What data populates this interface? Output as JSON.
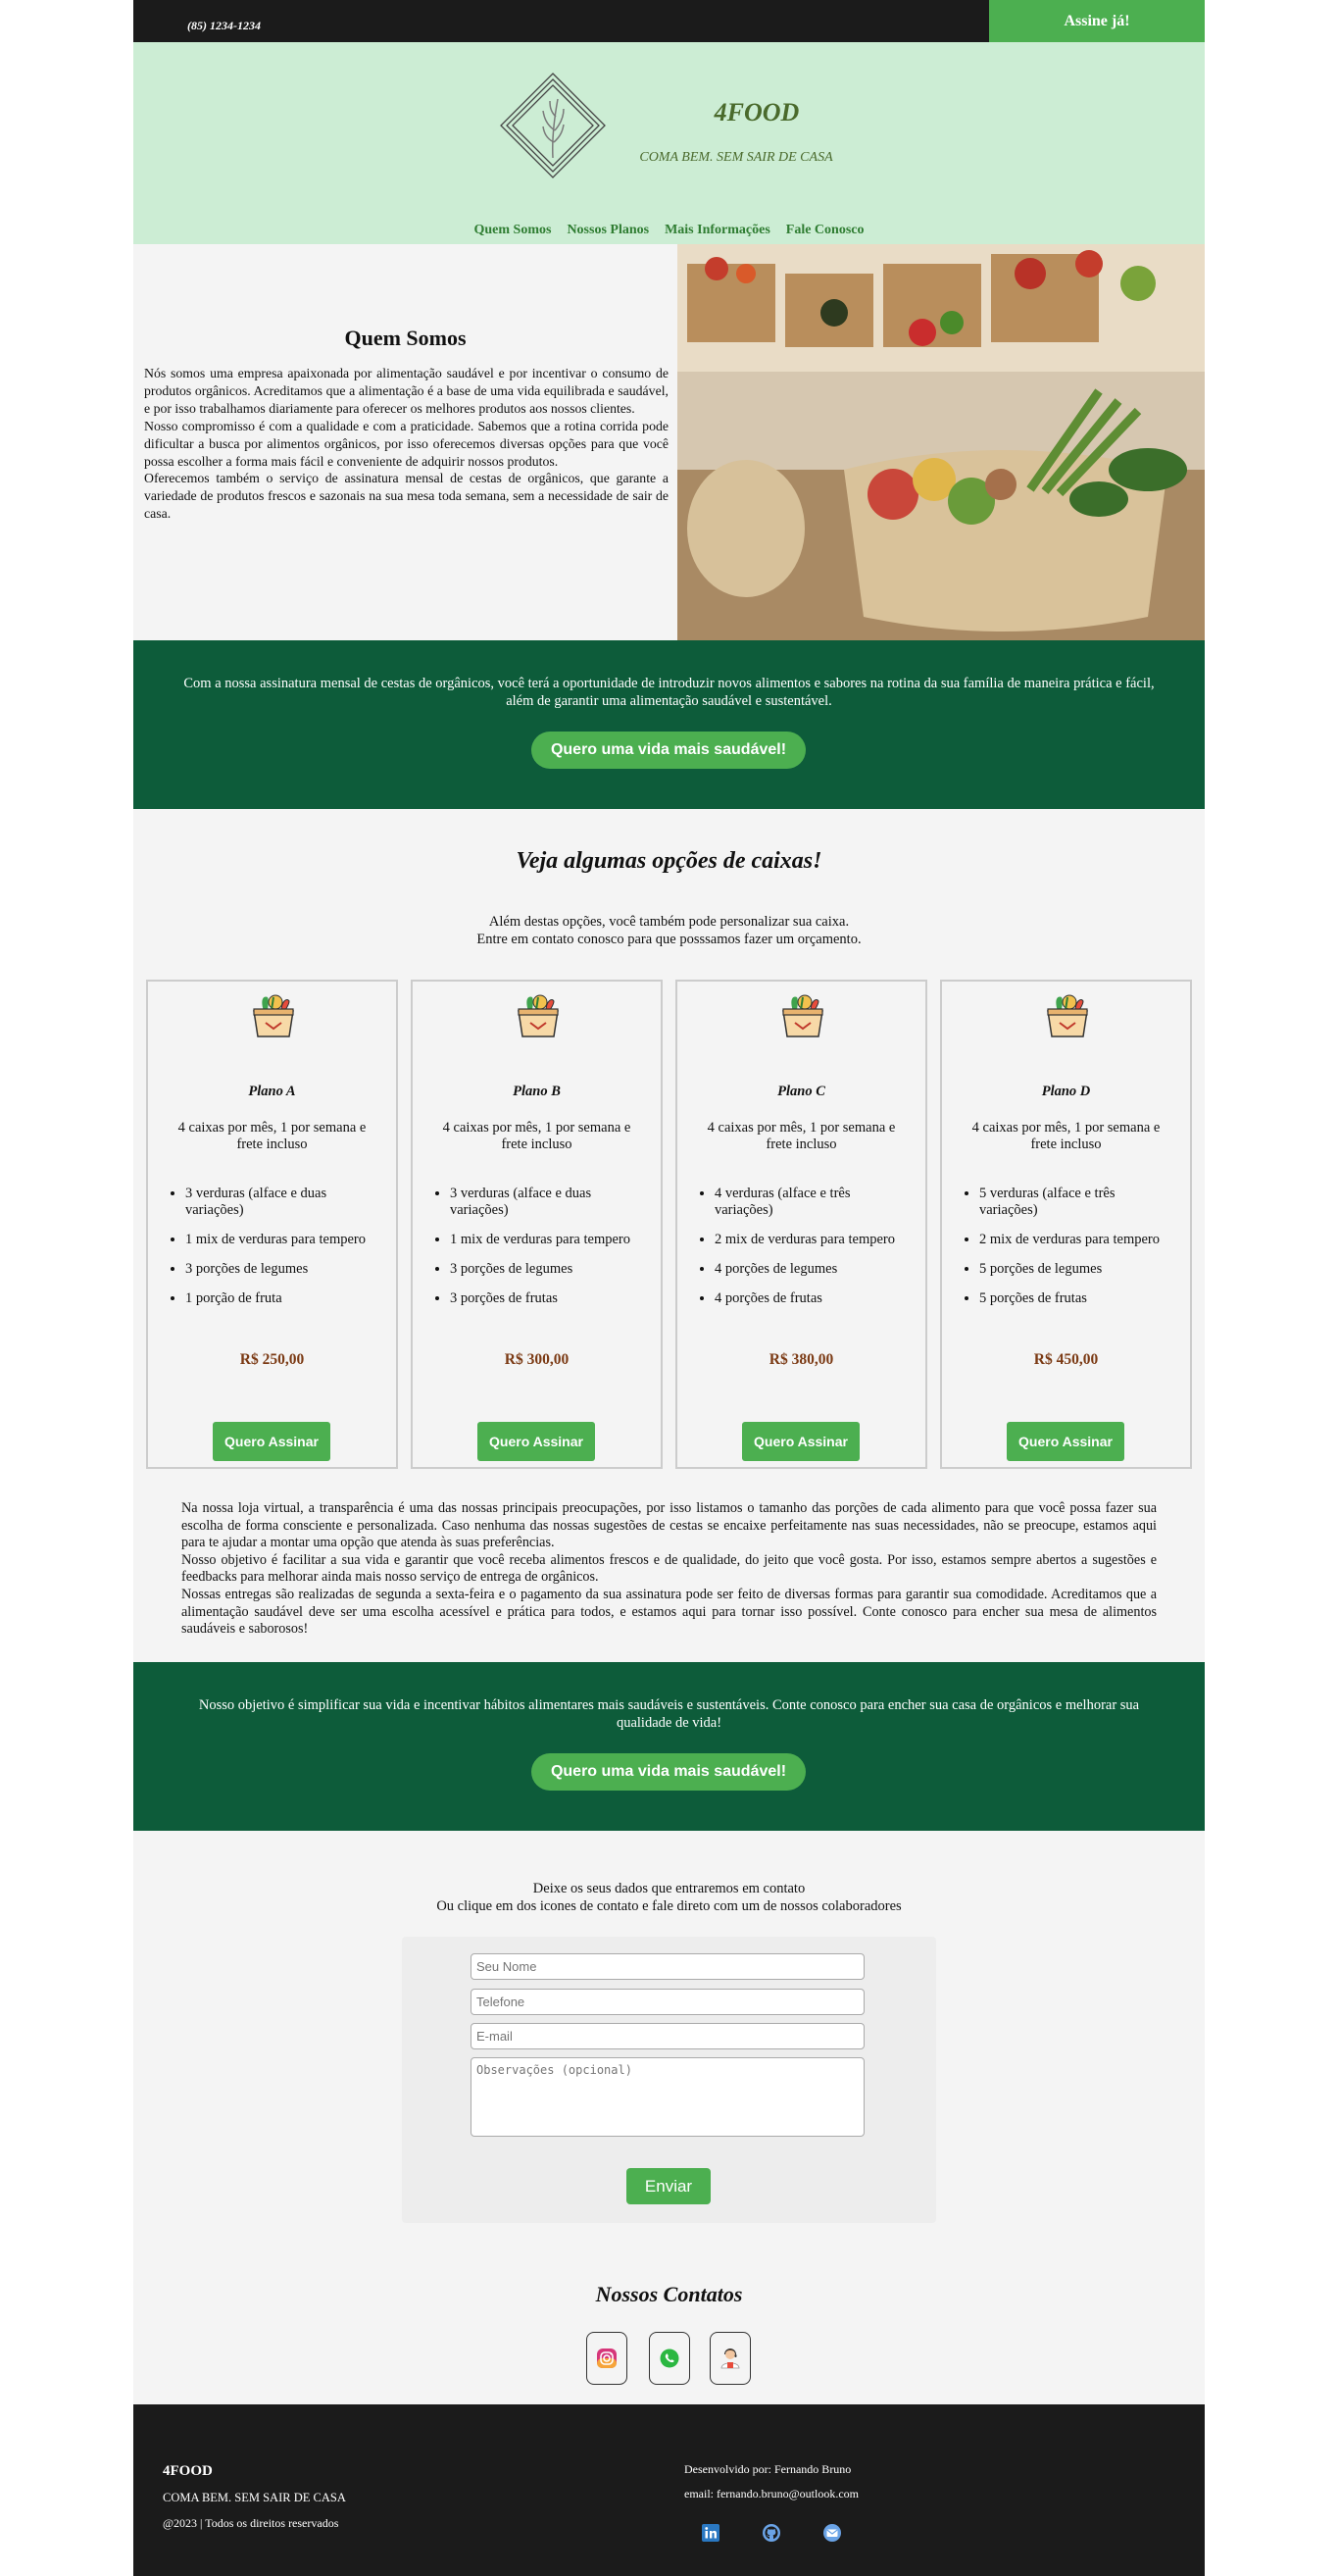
{
  "topbar": {
    "phone": "(85) 1234-1234",
    "cta": "Assine já!"
  },
  "header": {
    "brand": "4FOOD",
    "slogan": "COMA BEM. SEM SAIR DE CASA",
    "nav": [
      "Quem Somos",
      "Nossos Planos",
      "Mais Informações",
      "Fale Conosco"
    ]
  },
  "about": {
    "title": "Quem Somos",
    "p1": "Nós somos uma empresa apaixonada por alimentação saudável e por incentivar o consumo de produtos orgânicos. Acreditamos que a alimentação é a base de uma vida equilibrada e saudável, e por isso trabalhamos diariamente para oferecer os melhores produtos aos nossos clientes.",
    "p2": "Nosso compromisso é com a qualidade e com a praticidade. Sabemos que a rotina corrida pode dificultar a busca por alimentos orgânicos, por isso oferecemos diversas opções para que você possa escolher a forma mais fácil e conveniente de adquirir nossos produtos.",
    "p3": "Oferecemos também o serviço de assinatura mensal de cestas de orgânicos, que garante a variedade de produtos frescos e sazonais na sua mesa toda semana, sem a necessidade de sair de casa."
  },
  "banner1": {
    "text": "Com a nossa assinatura mensal de cestas de orgânicos, você terá a oportunidade de introduzir novos alimentos e sabores na rotina da sua família de maneira prática e fácil, além de garantir uma alimentação saudável e sustentável.",
    "cta": "Quero uma vida mais saudável!"
  },
  "plans": {
    "title": "Veja algumas opções de caixas!",
    "sub1": "Além destas opções, você também pode personalizar sua caixa.",
    "sub2": "Entre em contato conosco para que posssamos fazer um orçamento.",
    "buy_label": "Quero Assinar",
    "items": [
      {
        "name": "Plano A",
        "desc": "4 caixas por mês, 1 por semana e frete incluso",
        "items": [
          "3 verduras (alface e duas variações)",
          "1 mix de verduras para tempero",
          "3 porções de legumes",
          "1 porção de fruta"
        ],
        "price": "R$ 250,00"
      },
      {
        "name": "Plano B",
        "desc": "4 caixas por mês, 1 por semana e frete incluso",
        "items": [
          "3 verduras (alface e duas variações)",
          "1 mix de verduras para tempero",
          "3 porções de legumes",
          "3 porções de frutas"
        ],
        "price": "R$ 300,00"
      },
      {
        "name": "Plano C",
        "desc": "4 caixas por mês, 1 por semana e frete incluso",
        "items": [
          "4 verduras (alface e três variações)",
          "2 mix de verduras para tempero",
          "4 porções de legumes",
          "4 porções de frutas"
        ],
        "price": "R$ 380,00"
      },
      {
        "name": "Plano D",
        "desc": "4 caixas por mês, 1 por semana e frete incluso",
        "items": [
          "5 verduras (alface e três variações)",
          "2 mix de verduras para tempero",
          "5 porções de legumes",
          "5 porções de frutas"
        ],
        "price": "R$ 450,00"
      }
    ]
  },
  "info": {
    "p1": "Na nossa loja virtual, a transparência é uma das nossas principais preocupações, por isso listamos o tamanho das porções de cada alimento para que você possa fazer sua escolha de forma consciente e personalizada. Caso nenhuma das nossas sugestões de cestas se encaixe perfeitamente nas suas necessidades, não se preocupe, estamos aqui para te ajudar a montar uma opção que atenda às suas preferências.",
    "p2": "Nosso objetivo é facilitar a sua vida e garantir que você receba alimentos frescos e de qualidade, do jeito que você gosta. Por isso, estamos sempre abertos a sugestões e feedbacks para melhorar ainda mais nosso serviço de entrega de orgânicos.",
    "p3": "Nossas entregas são realizadas de segunda a sexta-feira e o pagamento da sua assinatura pode ser feito de diversas formas para garantir sua comodidade. Acreditamos que a alimentação saudável deve ser uma escolha acessível e prática para todos, e estamos aqui para tornar isso possível. Conte conosco para encher sua mesa de alimentos saudáveis e saborosos!"
  },
  "banner2": {
    "text": "Nosso objetivo é simplificar sua vida e incentivar hábitos alimentares mais saudáveis e sustentáveis. Conte conosco para encher sua casa de orgânicos e melhorar sua qualidade de vida!",
    "cta": "Quero uma vida mais saudável!"
  },
  "form": {
    "intro1": "Deixe os seus dados que entraremos em contato",
    "intro2": "Ou clique em dos icones de contato e fale direto com um de nossos colaboradores",
    "name_ph": "Seu Nome",
    "phone_ph": "Telefone",
    "email_ph": "E-mail",
    "notes_ph": "Observações (opcional)",
    "send": "Enviar"
  },
  "contacts": {
    "title": "Nossos Contatos",
    "icons": [
      "instagram-icon",
      "whatsapp-icon",
      "support-agent-icon"
    ]
  },
  "footer": {
    "brand": "4FOOD",
    "slogan": "COMA BEM. SEM SAIR DE CASA",
    "copyright": "@2023 | Todos os direitos reservados",
    "dev": "Desenvolvido por: Fernando Bruno",
    "email": "email: fernando.bruno@outlook.com",
    "icons": [
      "linkedin-icon",
      "github-icon",
      "mail-icon"
    ]
  },
  "colors": {
    "accent": "#4caf50",
    "dark_green": "#0d5c3a",
    "header_bg": "#ccedd4",
    "dark": "#1b1b1b",
    "price": "#7b3a14"
  }
}
